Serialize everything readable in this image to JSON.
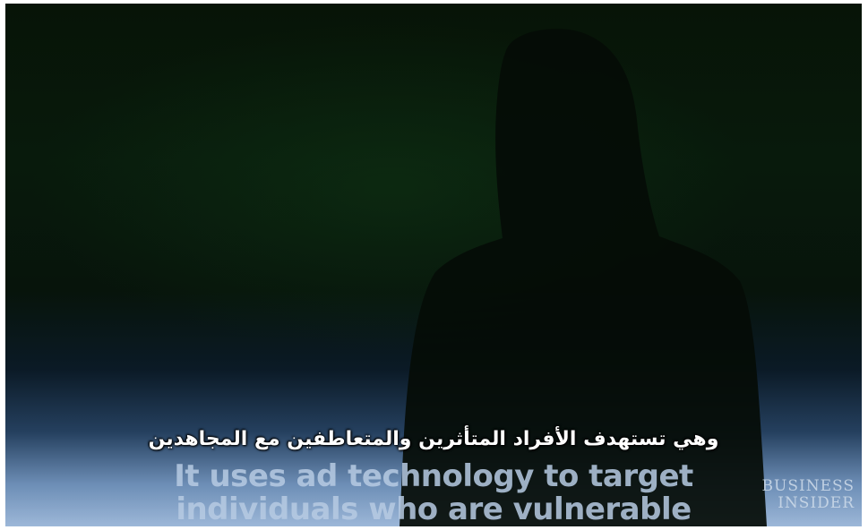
{
  "subtitles": {
    "arabic": "وهي تستهدف الأفراد المتأثرين والمتعاطفين مع المجاهدين",
    "english_line1": "It uses ad technology to target",
    "english_line2": "individuals who are vulnerable"
  },
  "logo": {
    "line1": "BUSINESS",
    "line2": "INSIDER"
  },
  "colors": {
    "background_dark": "#071407",
    "background_bottom": "#9cb7d8",
    "subtitle_text": "#ffffff"
  }
}
